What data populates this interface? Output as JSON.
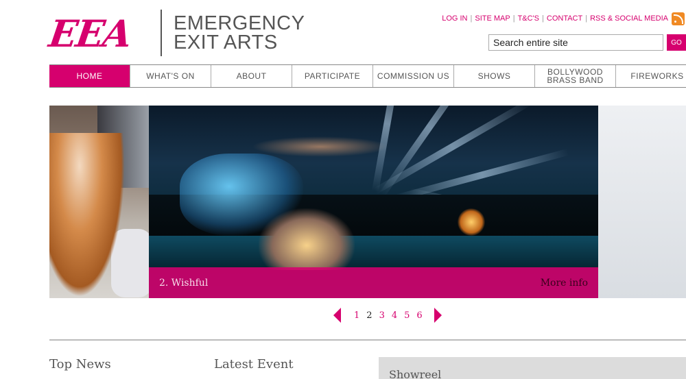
{
  "logo": {
    "mark": "EEA",
    "line1": "EMERGENCY",
    "line2": "EXIT ARTS"
  },
  "top_links": [
    "LOG IN",
    "SITE MAP",
    "T&C'S",
    "CONTACT",
    "RSS & SOCIAL MEDIA"
  ],
  "search": {
    "value": "Search entire site",
    "go_label": "GO"
  },
  "nav": [
    {
      "label": "HOME",
      "active": true
    },
    {
      "label": "WHAT'S ON"
    },
    {
      "label": "ABOUT"
    },
    {
      "label": "PARTICIPATE"
    },
    {
      "label": "COMMISSION US"
    },
    {
      "label": "SHOWS"
    },
    {
      "label": "BOLLYWOOD\nBRASS BAND"
    },
    {
      "label": "FIREWORKS"
    }
  ],
  "slider": {
    "caption": "2. Wishful",
    "more_info": "More info"
  },
  "pager": {
    "pages": [
      "1",
      "2",
      "3",
      "4",
      "5",
      "6"
    ],
    "current": "2"
  },
  "sections": {
    "top_news": "Top News",
    "latest_event": "Latest Event",
    "showreel": "Showreel"
  },
  "colors": {
    "accent": "#d6006e",
    "rss": "#f08a24"
  }
}
